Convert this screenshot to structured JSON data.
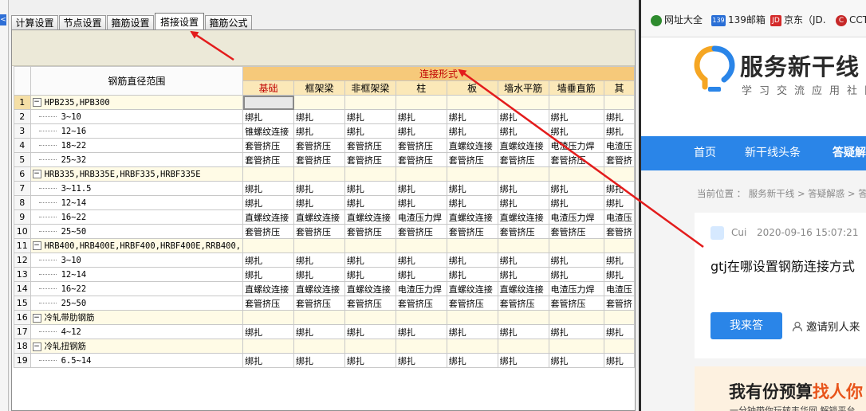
{
  "tabs": [
    "计算设置",
    "节点设置",
    "箍筋设置",
    "搭接设置",
    "箍筋公式"
  ],
  "active_tab": "搭接设置",
  "left_edge_glyph": "<",
  "grid": {
    "range_header": "钢筋直径范围",
    "conn_header": "连接形式",
    "columns": [
      "基础",
      "框架梁",
      "非框架梁",
      "柱",
      "板",
      "墙水平筋",
      "墙垂直筋",
      "其"
    ],
    "rows": [
      {
        "num": "1",
        "range": "HPB235,HPB300",
        "group": true,
        "cells": [
          "",
          "",
          "",
          "",
          "",
          "",
          "",
          ""
        ]
      },
      {
        "num": "2",
        "range": "3~10",
        "cells": [
          "绑扎",
          "绑扎",
          "绑扎",
          "绑扎",
          "绑扎",
          "绑扎",
          "绑扎",
          "绑扎"
        ]
      },
      {
        "num": "3",
        "range": "12~16",
        "cells": [
          "锥螺纹连接",
          "绑扎",
          "绑扎",
          "绑扎",
          "绑扎",
          "绑扎",
          "绑扎",
          "绑扎"
        ]
      },
      {
        "num": "4",
        "range": "18~22",
        "cells": [
          "套管挤压",
          "套管挤压",
          "套管挤压",
          "套管挤压",
          "直螺纹连接",
          "直螺纹连接",
          "电渣压力焊",
          "电渣压"
        ]
      },
      {
        "num": "5",
        "range": "25~32",
        "cells": [
          "套管挤压",
          "套管挤压",
          "套管挤压",
          "套管挤压",
          "套管挤压",
          "套管挤压",
          "套管挤压",
          "套管挤"
        ]
      },
      {
        "num": "6",
        "range": "HRB335,HRB335E,HRBF335,HRBF335E",
        "group": true,
        "cells": [
          "",
          "",
          "",
          "",
          "",
          "",
          "",
          ""
        ]
      },
      {
        "num": "7",
        "range": "3~11.5",
        "cells": [
          "绑扎",
          "绑扎",
          "绑扎",
          "绑扎",
          "绑扎",
          "绑扎",
          "绑扎",
          "绑扎"
        ]
      },
      {
        "num": "8",
        "range": "12~14",
        "cells": [
          "绑扎",
          "绑扎",
          "绑扎",
          "绑扎",
          "绑扎",
          "绑扎",
          "绑扎",
          "绑扎"
        ]
      },
      {
        "num": "9",
        "range": "16~22",
        "cells": [
          "直螺纹连接",
          "直螺纹连接",
          "直螺纹连接",
          "电渣压力焊",
          "直螺纹连接",
          "直螺纹连接",
          "电渣压力焊",
          "电渣压"
        ]
      },
      {
        "num": "10",
        "range": "25~50",
        "cells": [
          "套管挤压",
          "套管挤压",
          "套管挤压",
          "套管挤压",
          "套管挤压",
          "套管挤压",
          "套管挤压",
          "套管挤"
        ]
      },
      {
        "num": "11",
        "range": "HRB400,HRB400E,HRBF400,HRBF400E,RRB400,",
        "group": true,
        "cells": [
          "",
          "",
          "",
          "",
          "",
          "",
          "",
          ""
        ]
      },
      {
        "num": "12",
        "range": "3~10",
        "cells": [
          "绑扎",
          "绑扎",
          "绑扎",
          "绑扎",
          "绑扎",
          "绑扎",
          "绑扎",
          "绑扎"
        ]
      },
      {
        "num": "13",
        "range": "12~14",
        "cells": [
          "绑扎",
          "绑扎",
          "绑扎",
          "绑扎",
          "绑扎",
          "绑扎",
          "绑扎",
          "绑扎"
        ]
      },
      {
        "num": "14",
        "range": "16~22",
        "cells": [
          "直螺纹连接",
          "直螺纹连接",
          "直螺纹连接",
          "电渣压力焊",
          "直螺纹连接",
          "直螺纹连接",
          "电渣压力焊",
          "电渣压"
        ]
      },
      {
        "num": "15",
        "range": "25~50",
        "cells": [
          "套管挤压",
          "套管挤压",
          "套管挤压",
          "套管挤压",
          "套管挤压",
          "套管挤压",
          "套管挤压",
          "套管挤"
        ]
      },
      {
        "num": "16",
        "range": "冷轧带肋钢筋",
        "group": true,
        "cells": [
          "",
          "",
          "",
          "",
          "",
          "",
          "",
          ""
        ]
      },
      {
        "num": "17",
        "range": "4~12",
        "cells": [
          "绑扎",
          "绑扎",
          "绑扎",
          "绑扎",
          "绑扎",
          "绑扎",
          "绑扎",
          "绑扎"
        ]
      },
      {
        "num": "18",
        "range": "冷轧扭钢筋",
        "group": true,
        "cells": [
          "",
          "",
          "",
          "",
          "",
          "",
          "",
          ""
        ]
      },
      {
        "num": "19",
        "range": "6.5~14",
        "cells": [
          "绑扎",
          "绑扎",
          "绑扎",
          "绑扎",
          "绑扎",
          "绑扎",
          "绑扎",
          "绑扎"
        ]
      }
    ]
  },
  "browser": {
    "bookmarks": [
      {
        "label": "网址大全",
        "icon": "portal-icon",
        "color": "#2e8b2e"
      },
      {
        "label": "139邮箱",
        "icon": "mail-icon",
        "color": "#2a6fd6"
      },
      {
        "label": "京东（JD.",
        "icon": "jd-icon",
        "color": "#d42a2a"
      },
      {
        "label": "CCT",
        "icon": "cctv-icon",
        "color": "#c62828"
      }
    ],
    "bookmark_badges": [
      "",
      "139",
      "JD",
      "C"
    ],
    "site_name": "服务新干线",
    "site_tagline": "学习交流应用社区",
    "nav": [
      "首页",
      "新干线头条",
      "答疑解"
    ],
    "breadcrumb": "当前位置 ： 服务新干线 > 答疑解惑 > 答",
    "question_user": "Cui",
    "question_time": "2020-09-16 15:07:21",
    "question_title": "gtj在哪设置钢筋连接方式",
    "answer_button": "我来答",
    "invite_text": "邀请别人来",
    "banner_text_plain": "我有份预算",
    "banner_text_accent": "找人你",
    "banner_sub": "一分钟带你玩转韦华网 解锁平台"
  },
  "colors": {
    "arrow": "#e31c1c",
    "brand_blue": "#2a85e8",
    "conn_header_bg": "#f6c97a",
    "column_header_bg": "#fbe8b8",
    "group_row_bg": "#fffbe6"
  }
}
